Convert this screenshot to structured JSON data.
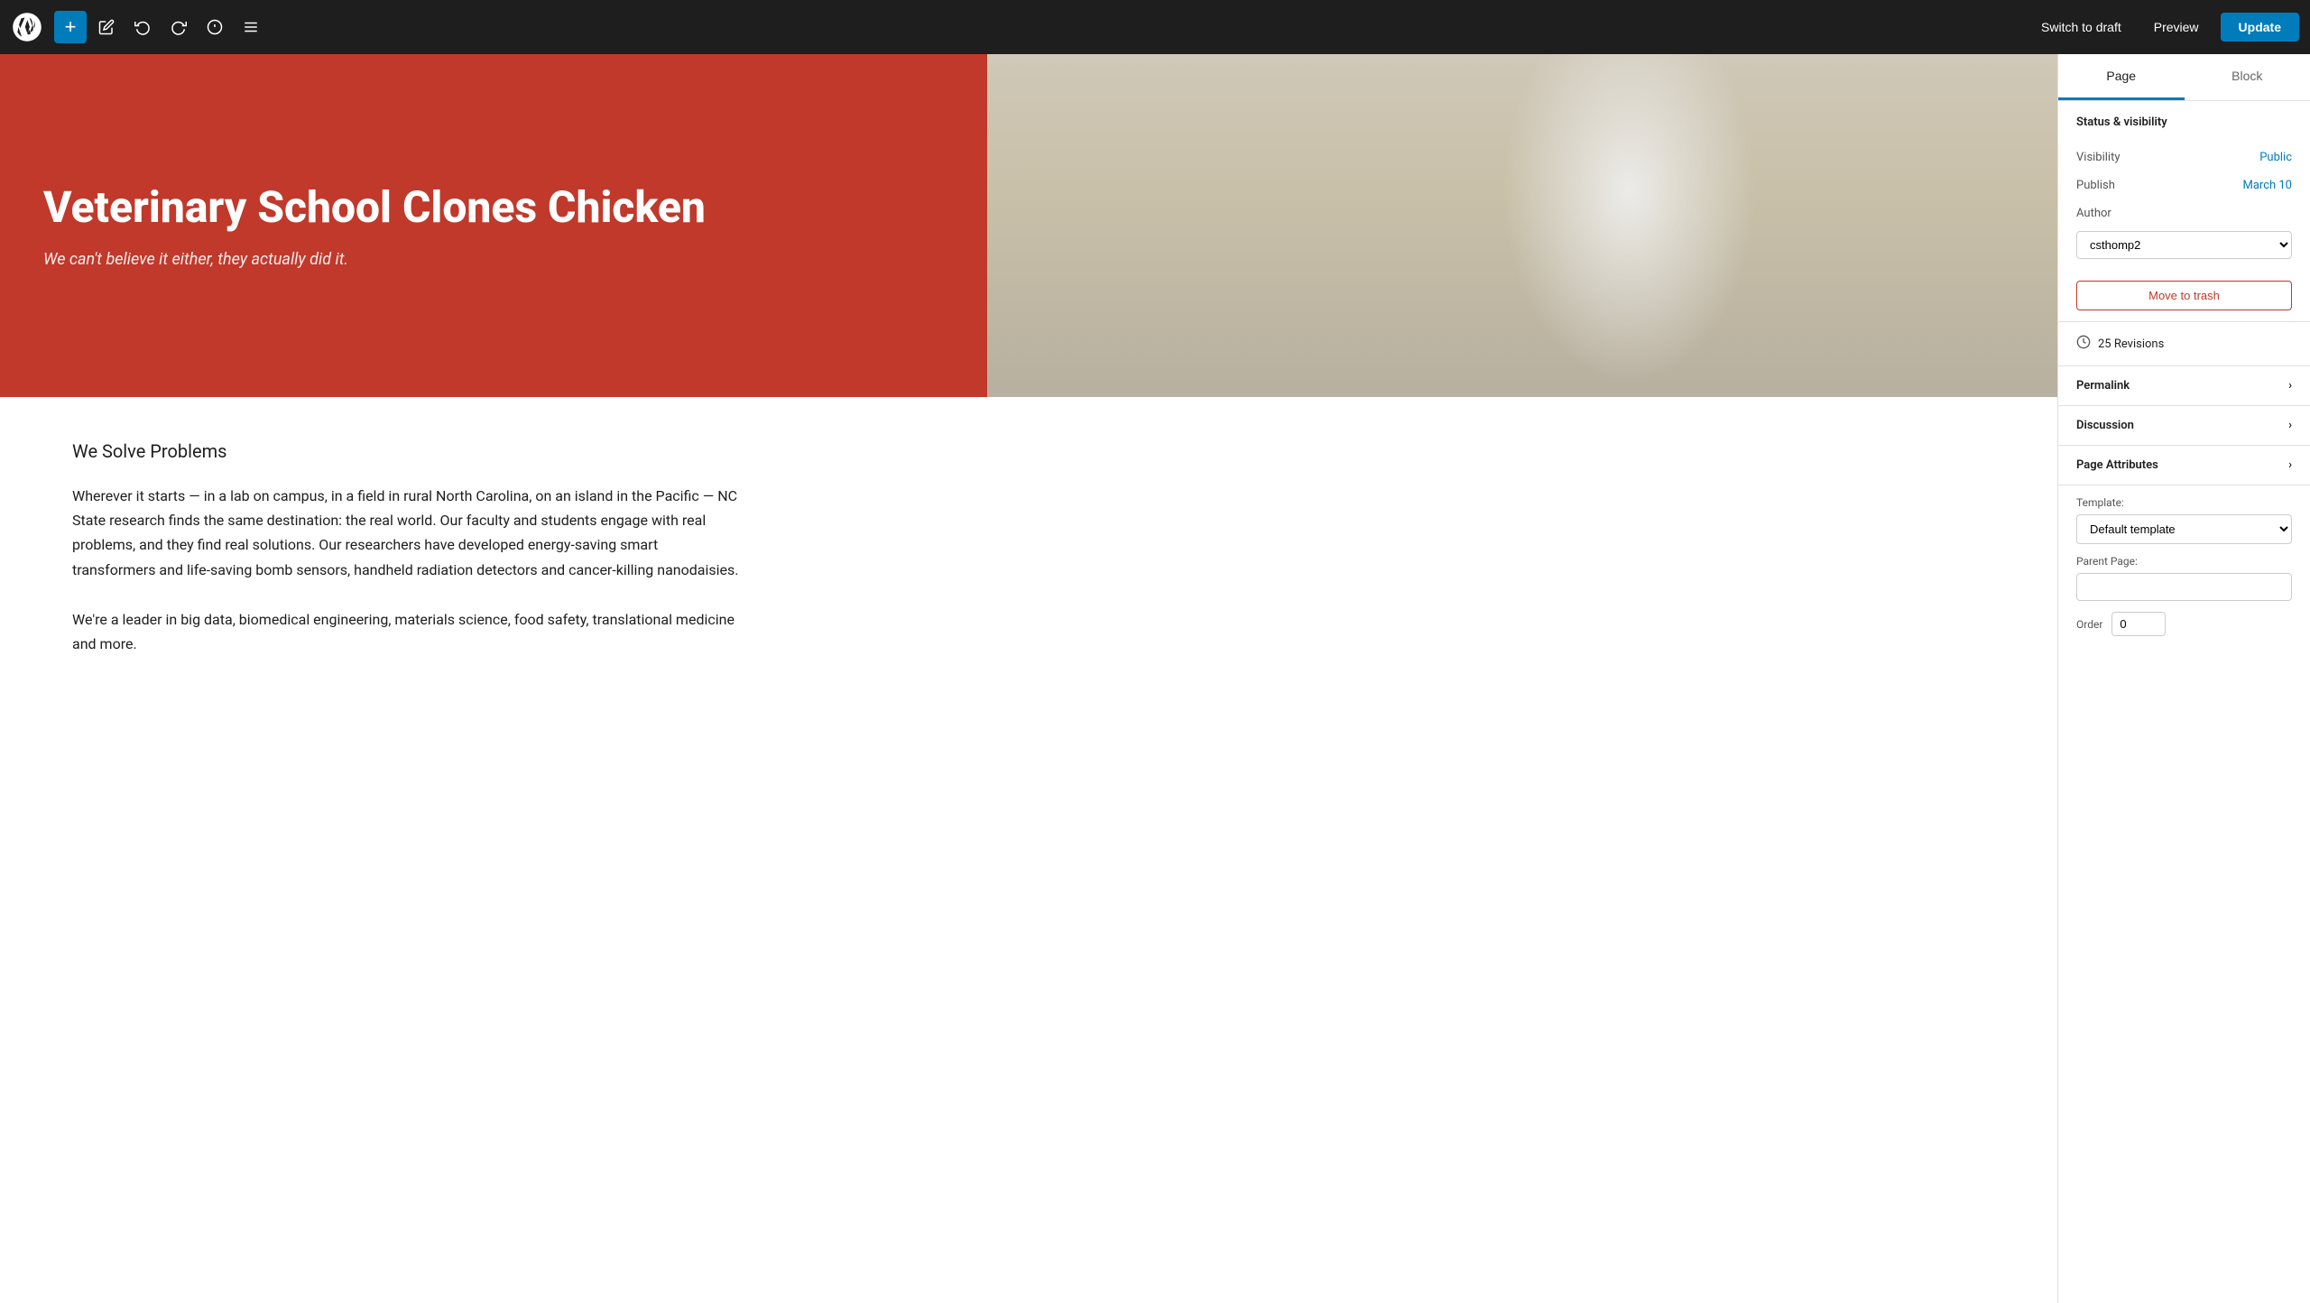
{
  "toolbar": {
    "add_label": "+",
    "pencil_icon": "✏",
    "undo_icon": "↩",
    "redo_icon": "↪",
    "info_icon": "ℹ",
    "list_icon": "≡",
    "switch_to_draft_label": "Switch to draft",
    "preview_label": "Preview",
    "update_label": "Update"
  },
  "sidebar": {
    "tab_page": "Page",
    "tab_block": "Block",
    "status_visibility_label": "Status & visibility",
    "visibility_label": "Visibility",
    "visibility_value": "Public",
    "publish_label": "Publish",
    "publish_value": "March 10",
    "author_label": "Author",
    "author_value": "csthomp2",
    "move_to_trash_label": "Move to trash",
    "revisions_label": "25 Revisions",
    "permalink_label": "Permalink",
    "discussion_label": "Discussion",
    "page_attributes_label": "Page Attributes",
    "template_label": "Template:",
    "template_value": "Default template",
    "parent_page_label": "Parent Page:",
    "parent_page_value": "",
    "order_label": "Order",
    "order_value": "0"
  },
  "hero": {
    "title": "Veterinary School Clones Chicken",
    "subtitle": "We can't believe it either, they actually did it."
  },
  "content": {
    "section_title": "We Solve Problems",
    "body1": "Wherever it starts — in a lab on campus, in a field in rural North Carolina, on an island in the Pacific — NC State research finds the same destination: the real world. Our faculty and students engage with real problems, and they find real solutions. Our researchers have developed energy-saving smart transformers and life-saving bomb sensors, handheld radiation detectors and cancer-killing nanodaisies.",
    "link_text": "nanodaisies",
    "body2": "We're a leader in big data, biomedical engineering, materials science, food safety, translational medicine and more."
  }
}
